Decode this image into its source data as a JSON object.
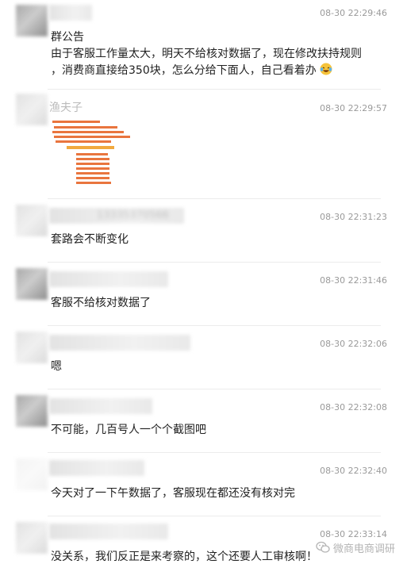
{
  "messages": [
    {
      "time": "08-30 22:29:46",
      "lines": [
        "群公告",
        "由于客服工作量太大，明天不给核对数据了，现在修改扶持规则",
        "，消费商直接给350块，怎么分给下面人，自己看着办"
      ]
    },
    {
      "sender": "渔夫子",
      "time": "08-30 22:29:57"
    },
    {
      "sender_partial": "13335370566",
      "time": "08-30 22:31:23",
      "text": "套路会不断变化"
    },
    {
      "time": "08-30 22:31:46",
      "text": "客服不给核对数据了"
    },
    {
      "time": "08-30 22:32:06",
      "text": "嗯"
    },
    {
      "time": "08-30 22:32:08",
      "text": "不可能，几百号人一个个截图吧"
    },
    {
      "time": "08-30 22:32:40",
      "text": "今天对了一下午数据了，客服现在都还没有核对完"
    },
    {
      "time": "08-30 22:33:14",
      "text": "没关系，我们反正是来考察的，这个还要人工审核啊！"
    }
  ],
  "watermark": "微商电商调研",
  "icons": {
    "emoji": "laughing-crying-emoji",
    "watermark": "wechat-logo-icon"
  }
}
